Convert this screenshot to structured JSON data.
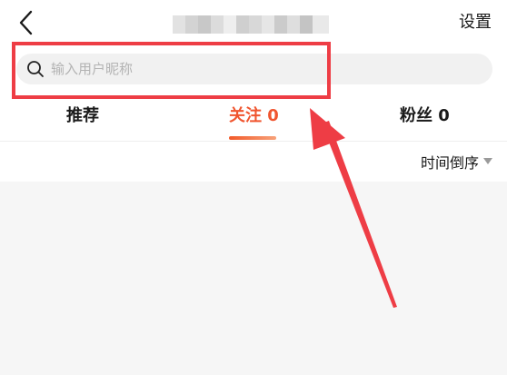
{
  "header": {
    "settings_label": "设置"
  },
  "search": {
    "placeholder": "输入用户昵称"
  },
  "tabs": [
    {
      "label": "推荐"
    },
    {
      "label": "关注 0"
    },
    {
      "label": "粉丝 0"
    }
  ],
  "sort": {
    "label": "时间倒序"
  },
  "colors": {
    "accent": "#f0552f",
    "annotation_red": "#ee3d45"
  }
}
